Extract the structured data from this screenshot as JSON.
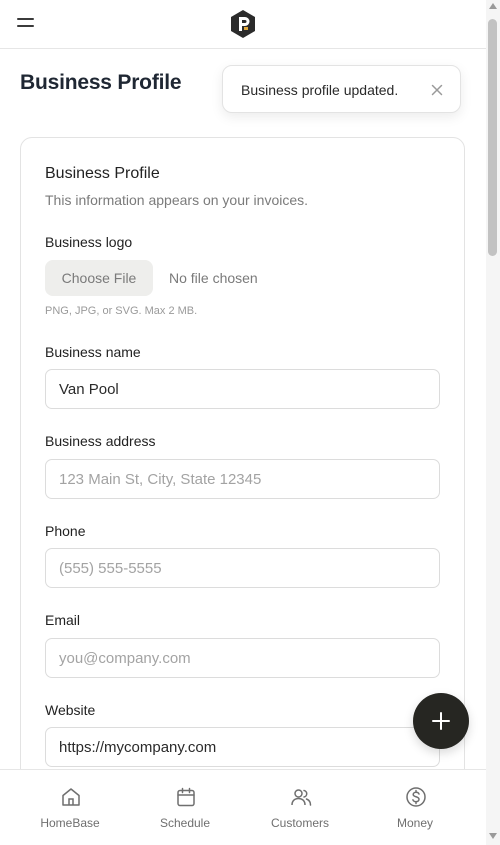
{
  "header": {
    "menu_icon": "hamburger-menu-icon",
    "logo_icon": "app-logo-icon"
  },
  "page_title": "Business Profile",
  "toast": {
    "message": "Business profile updated.",
    "close_icon": "close-icon"
  },
  "card": {
    "title": "Business Profile",
    "subtitle": "This information appears on your invoices."
  },
  "logo_field": {
    "label": "Business logo",
    "button_label": "Choose File",
    "status": "No file chosen",
    "hint": "PNG, JPG, or SVG. Max 2 MB."
  },
  "fields": {
    "business_name": {
      "label": "Business name",
      "value": "Van Pool",
      "placeholder": ""
    },
    "business_address": {
      "label": "Business address",
      "value": "",
      "placeholder": "123 Main St, City, State 12345"
    },
    "phone": {
      "label": "Phone",
      "value": "",
      "placeholder": "(555) 555-5555"
    },
    "email": {
      "label": "Email",
      "value": "",
      "placeholder": "you@company.com"
    },
    "website": {
      "label": "Website",
      "value": "https://mycompany.com",
      "placeholder": ""
    }
  },
  "fab": {
    "icon": "plus-icon"
  },
  "bottom_nav": [
    {
      "label": "HomeBase",
      "icon": "home-icon"
    },
    {
      "label": "Schedule",
      "icon": "calendar-icon"
    },
    {
      "label": "Customers",
      "icon": "users-icon"
    },
    {
      "label": "Money",
      "icon": "dollar-circle-icon"
    }
  ],
  "colors": {
    "fab_background": "#262622",
    "icon_stroke": "#6f6f6f",
    "logo_fill": "#2b2b2b"
  }
}
